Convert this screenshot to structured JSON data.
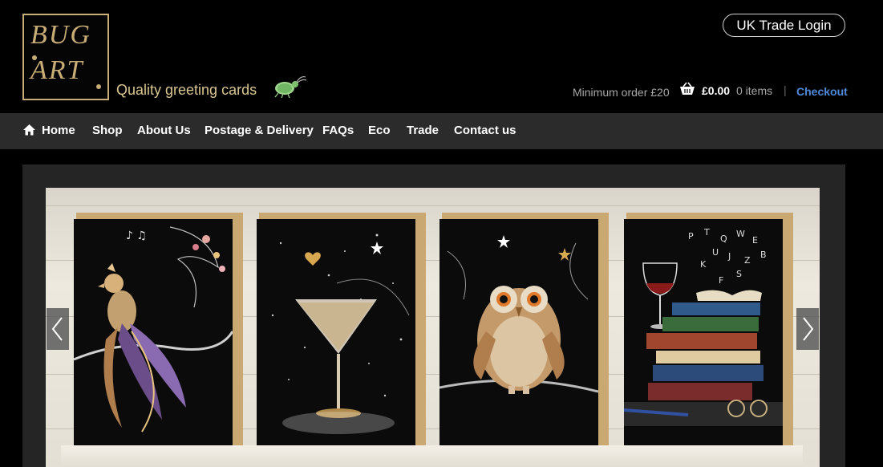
{
  "brand": {
    "logo_line1": "BUG",
    "logo_line2": "ART",
    "tagline": "Quality greeting cards"
  },
  "header": {
    "trade_login": "UK Trade Login",
    "minimum_order": "Minimum order £20",
    "cart_total": "£0.00",
    "cart_items": "0 items",
    "separator": "|",
    "checkout": "Checkout"
  },
  "nav": {
    "items": [
      {
        "label": "Home"
      },
      {
        "label": "Shop"
      },
      {
        "label": "About Us"
      },
      {
        "label": "Postage & Delivery"
      },
      {
        "label": "FAQs"
      },
      {
        "label": "Eco"
      },
      {
        "label": "Trade"
      },
      {
        "label": "Contact us"
      }
    ]
  },
  "slider": {
    "cards": [
      {
        "subject": "bird of paradise with flowers and music notes"
      },
      {
        "subject": "martini glass with sparkles and heart"
      },
      {
        "subject": "patterned owl on branch with stars"
      },
      {
        "subject": "stack of books, wine glass and spectacles"
      }
    ],
    "prev_icon": "chevron-left-icon",
    "next_icon": "chevron-right-icon"
  },
  "colors": {
    "gold": "#c9ad76",
    "nav_bg": "#2b2b2b",
    "checkout_link": "#4d8ad9"
  }
}
